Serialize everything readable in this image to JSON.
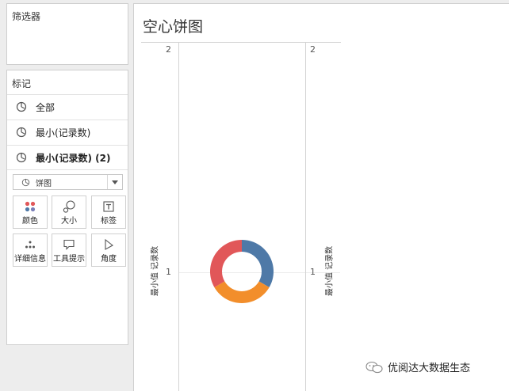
{
  "filters": {
    "title": "筛选器"
  },
  "marks": {
    "title": "标记",
    "rows": [
      {
        "label": "全部",
        "icon": "pie-icon"
      },
      {
        "label": "最小(记录数)",
        "icon": "pie-icon"
      },
      {
        "label": "最小(记录数) (2)",
        "icon": "pie-icon"
      }
    ],
    "mark_type": "饼图",
    "cards": [
      {
        "label": "颜色",
        "icon": "color-icon"
      },
      {
        "label": "大小",
        "icon": "size-icon"
      },
      {
        "label": "标签",
        "icon": "label-icon"
      },
      {
        "label": "详细信息",
        "icon": "detail-icon"
      },
      {
        "label": "工具提示",
        "icon": "tooltip-icon"
      },
      {
        "label": "角度",
        "icon": "angle-icon"
      }
    ]
  },
  "sheet": {
    "title": "空心饼图",
    "left_axis": {
      "label": "最小值 记录数",
      "ticks": [
        "2",
        "1"
      ]
    },
    "right_axis": {
      "label": "最小值 记录数",
      "ticks": [
        "2",
        "1"
      ]
    }
  },
  "chart_data": {
    "type": "pie",
    "style": "donut",
    "slices": [
      {
        "value": 1,
        "color": "#4e79a7"
      },
      {
        "value": 1,
        "color": "#f28e2b"
      },
      {
        "value": 1,
        "color": "#e15759"
      }
    ],
    "ylim": [
      0,
      2
    ]
  },
  "watermark": {
    "text": "优阅达大数据生态"
  },
  "colors": {
    "accent_blue": "#4e79a7",
    "accent_orange": "#f28e2b",
    "accent_red": "#e15759"
  }
}
